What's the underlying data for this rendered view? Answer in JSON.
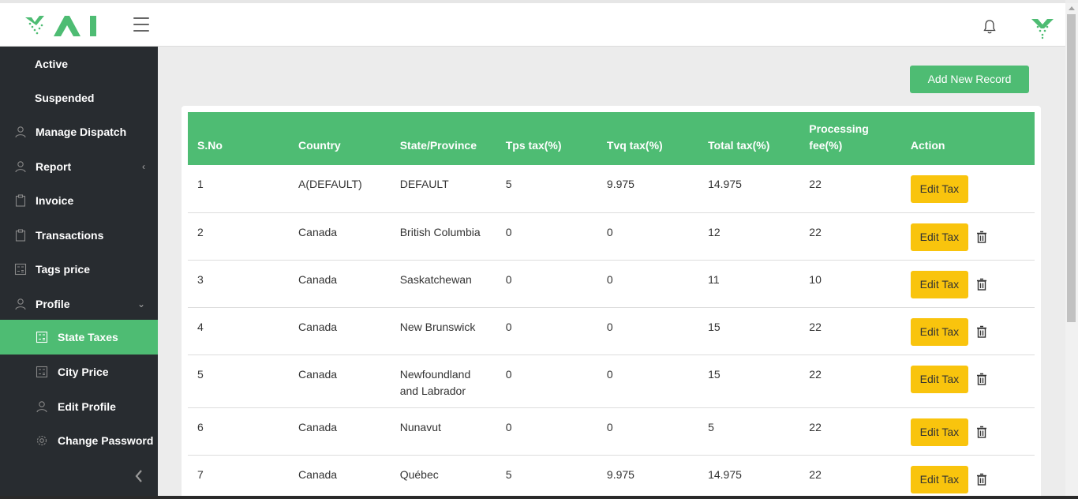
{
  "header": {
    "logo_alt": "YAI",
    "brand_color": "#4ebc73"
  },
  "sidebar": {
    "items": [
      {
        "label": "Active",
        "icon": "none"
      },
      {
        "label": "Suspended",
        "icon": "none"
      },
      {
        "label": "Manage Dispatch",
        "icon": "user-icon"
      },
      {
        "label": "Report",
        "icon": "user-icon",
        "chevron": "‹"
      },
      {
        "label": "Invoice",
        "icon": "clipboard-icon"
      },
      {
        "label": "Transactions",
        "icon": "clipboard-icon"
      },
      {
        "label": "Tags price",
        "icon": "calculator-icon"
      },
      {
        "label": "Profile",
        "icon": "user-icon",
        "chevron": "⌄"
      },
      {
        "label": "State Taxes",
        "icon": "calculator-icon",
        "active": true
      },
      {
        "label": "City Price",
        "icon": "calculator-icon"
      },
      {
        "label": "Edit Profile",
        "icon": "user-icon"
      },
      {
        "label": "Change Password",
        "icon": "gear-icon"
      }
    ]
  },
  "main": {
    "add_button": "Add New Record",
    "columns": [
      "S.No",
      "Country",
      "State/Province",
      "Tps tax(%)",
      "Tvq tax(%)",
      "Total tax(%)",
      "Processing fee(%)",
      "Action"
    ],
    "edit_label": "Edit Tax",
    "rows": [
      {
        "sno": "1",
        "country": "A(DEFAULT)",
        "state": "DEFAULT",
        "tps": "5",
        "tvq": "9.975",
        "total": "14.975",
        "fee": "22",
        "deletable": false
      },
      {
        "sno": "2",
        "country": "Canada",
        "state": "British Columbia",
        "tps": "0",
        "tvq": "0",
        "total": "12",
        "fee": "22",
        "deletable": true
      },
      {
        "sno": "3",
        "country": "Canada",
        "state": "Saskatchewan",
        "tps": "0",
        "tvq": "0",
        "total": "11",
        "fee": "10",
        "deletable": true
      },
      {
        "sno": "4",
        "country": "Canada",
        "state": "New Brunswick",
        "tps": "0",
        "tvq": "0",
        "total": "15",
        "fee": "22",
        "deletable": true
      },
      {
        "sno": "5",
        "country": "Canada",
        "state": "Newfoundland and Labrador",
        "tps": "0",
        "tvq": "0",
        "total": "15",
        "fee": "22",
        "deletable": true
      },
      {
        "sno": "6",
        "country": "Canada",
        "state": "Nunavut",
        "tps": "0",
        "tvq": "0",
        "total": "5",
        "fee": "22",
        "deletable": true
      },
      {
        "sno": "7",
        "country": "Canada",
        "state": "Québec",
        "tps": "5",
        "tvq": "9.975",
        "total": "14.975",
        "fee": "22",
        "deletable": true
      }
    ]
  }
}
